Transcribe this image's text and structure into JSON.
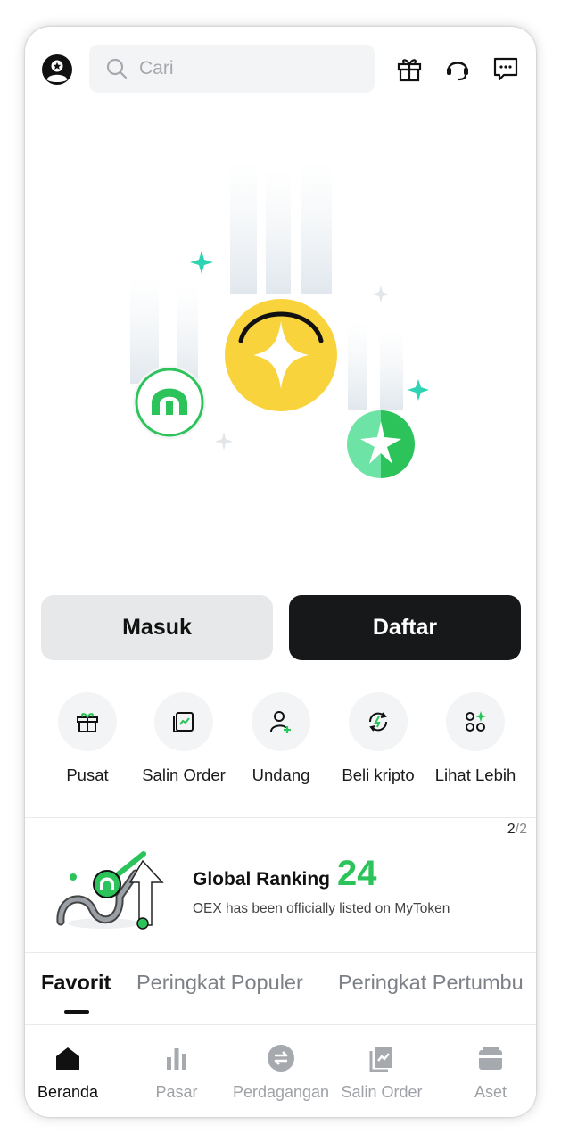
{
  "header": {
    "search_placeholder": "Cari",
    "icons": [
      "avatar-icon",
      "search-icon",
      "gift-icon",
      "headset-icon",
      "message-icon"
    ]
  },
  "auth": {
    "login_label": "Masuk",
    "register_label": "Daftar"
  },
  "quick_actions": [
    {
      "label": "Pusat",
      "icon": "gift-icon"
    },
    {
      "label": "Salin Order",
      "icon": "copy-order-icon"
    },
    {
      "label": "Undang",
      "icon": "invite-user-icon"
    },
    {
      "label": "Beli kripto",
      "icon": "buy-crypto-icon"
    },
    {
      "label": "Lihat Lebih",
      "icon": "more-apps-icon"
    }
  ],
  "banner": {
    "pager_current": "2",
    "pager_separator": "/",
    "pager_total": "2",
    "title": "Global Ranking",
    "number": "24",
    "subtitle": "OEX has been officially listed on MyToken"
  },
  "tabs": [
    {
      "label": "Favorit",
      "active": true
    },
    {
      "label": "Peringkat Populer",
      "active": false
    },
    {
      "label": "Peringkat Pertumbu",
      "active": false
    }
  ],
  "nav": [
    {
      "label": "Beranda",
      "icon": "home-icon",
      "active": true
    },
    {
      "label": "Pasar",
      "icon": "market-icon",
      "active": false
    },
    {
      "label": "Perdagangan",
      "icon": "trade-icon",
      "active": false
    },
    {
      "label": "Salin Order",
      "icon": "copy-order-icon",
      "active": false
    },
    {
      "label": "Aset",
      "icon": "wallet-icon",
      "active": false
    }
  ],
  "colors": {
    "accent_green": "#2bc35a",
    "coin_yellow": "#f8d33b",
    "dark_button": "#17181a",
    "light_button": "#e6e8e9"
  }
}
